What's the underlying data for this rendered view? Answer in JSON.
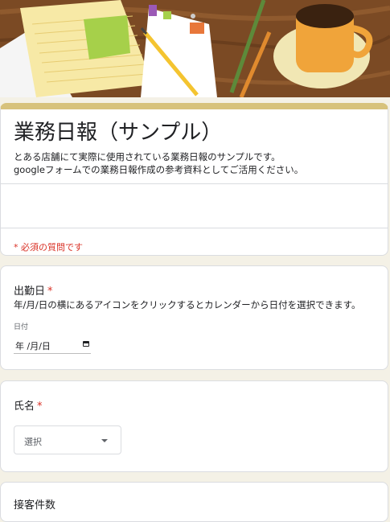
{
  "form": {
    "title": "業務日報（サンプル）",
    "description_line1": "とある店舗にて実際に使用されている業務日報のサンプルです。",
    "description_line2": "googleフォームでの業務日報作成の参考資料としてご活用ください。",
    "required_note": "* 必須の質問です"
  },
  "questions": [
    {
      "title": "出勤日",
      "required_mark": "*",
      "help": "年/月/日の横にあるアイコンをクリックするとカレンダーから日付を選択できます。",
      "field_label": "日付",
      "value": "年 /月/日"
    },
    {
      "title": "氏名",
      "required_mark": "*",
      "value": "選択"
    },
    {
      "title": "接客件数"
    }
  ],
  "icons": {
    "date": "calendar-icon",
    "dropdown": "chevron-down-icon"
  },
  "colors": {
    "page_bg": "#f4f1e6",
    "header_accent": "#d7c27c",
    "required": "#d93025"
  }
}
